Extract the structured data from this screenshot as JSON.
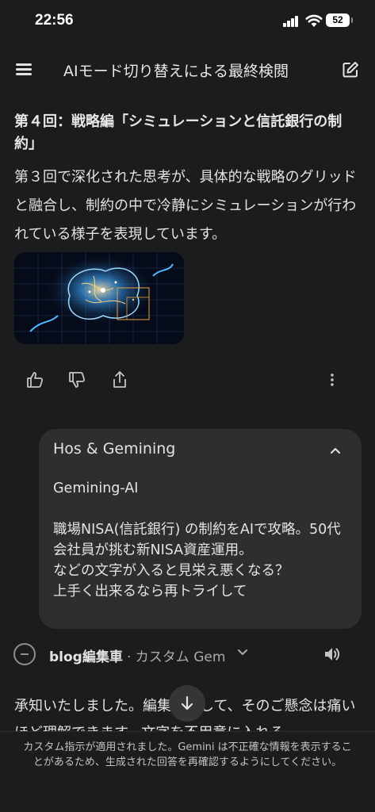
{
  "status": {
    "time": "22:56",
    "battery": "52"
  },
  "header": {
    "title": "AIモード切り替えによる最終検閲"
  },
  "message": {
    "heading": "第４回：戦略編「シミュレーションと信託銀行の制約」",
    "paragraph": "第３回で深化された思考が、具体的な戦略のグリッドと融合し、制約の中で冷静にシミュレーションが行われている様子を表現しています。"
  },
  "user_card": {
    "title": "Hos & Gemining",
    "lines": [
      "Gemining-AI",
      "",
      "職場NISA(信託銀行) の制約をAIで攻略。50代会社員が挑む新NISA資産運用。",
      "などの文字が入ると見栄え悪くなる？",
      "上手く出来るなら再トライして"
    ]
  },
  "gem": {
    "name": "blog編集車",
    "subtitle": "· カスタム Gem"
  },
  "reply": {
    "text": "承知いたしました。編集者として、そのご懸念は痛いほど理解できます。文字を不用意に入れる"
  },
  "footer": {
    "disclaimer": "カスタム指示が適用されました。Gemini は不正確な情報を表示することがあるため、生成された回答を再確認するようにしてください。"
  }
}
